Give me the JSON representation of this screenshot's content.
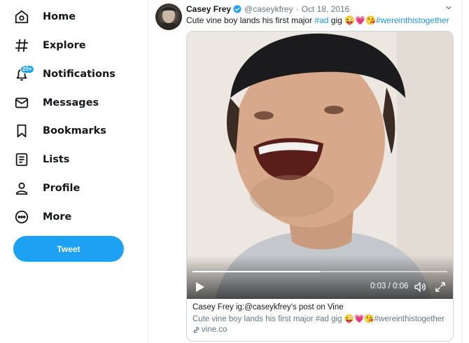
{
  "sidebar": {
    "items": [
      {
        "label": "Home",
        "icon": "home-icon"
      },
      {
        "label": "Explore",
        "icon": "hashtag-icon"
      },
      {
        "label": "Notifications",
        "icon": "bell-icon",
        "badge": "20+"
      },
      {
        "label": "Messages",
        "icon": "envelope-icon"
      },
      {
        "label": "Bookmarks",
        "icon": "bookmark-icon"
      },
      {
        "label": "Lists",
        "icon": "list-icon"
      },
      {
        "label": "Profile",
        "icon": "person-icon"
      },
      {
        "label": "More",
        "icon": "more-icon"
      }
    ],
    "tweet_button": "Tweet"
  },
  "tweet": {
    "author_name": "Casey Frey",
    "handle": "@caseykfrey",
    "separator": "·",
    "date": "Oct 18, 2016",
    "text_before": "Cute vine boy lands his first major ",
    "hashtag_ad": "#ad",
    "text_middle": " gig 😜💗😘",
    "hashtag_together": "#wereinthistogether"
  },
  "card": {
    "video": {
      "current_time": "0:03",
      "duration": "0:06",
      "time_separator": " / ",
      "progress": 0.5
    },
    "title": "Casey Frey ig:@caseykfrey's post on Vine",
    "description": "Cute vine boy lands his first major #ad gig 😜💗😘#wereinthistogether",
    "domain": "vine.co"
  },
  "colors": {
    "accent": "#1da1f2",
    "hashtag": "#1b95e0",
    "muted": "#657786",
    "text": "#14171a"
  }
}
